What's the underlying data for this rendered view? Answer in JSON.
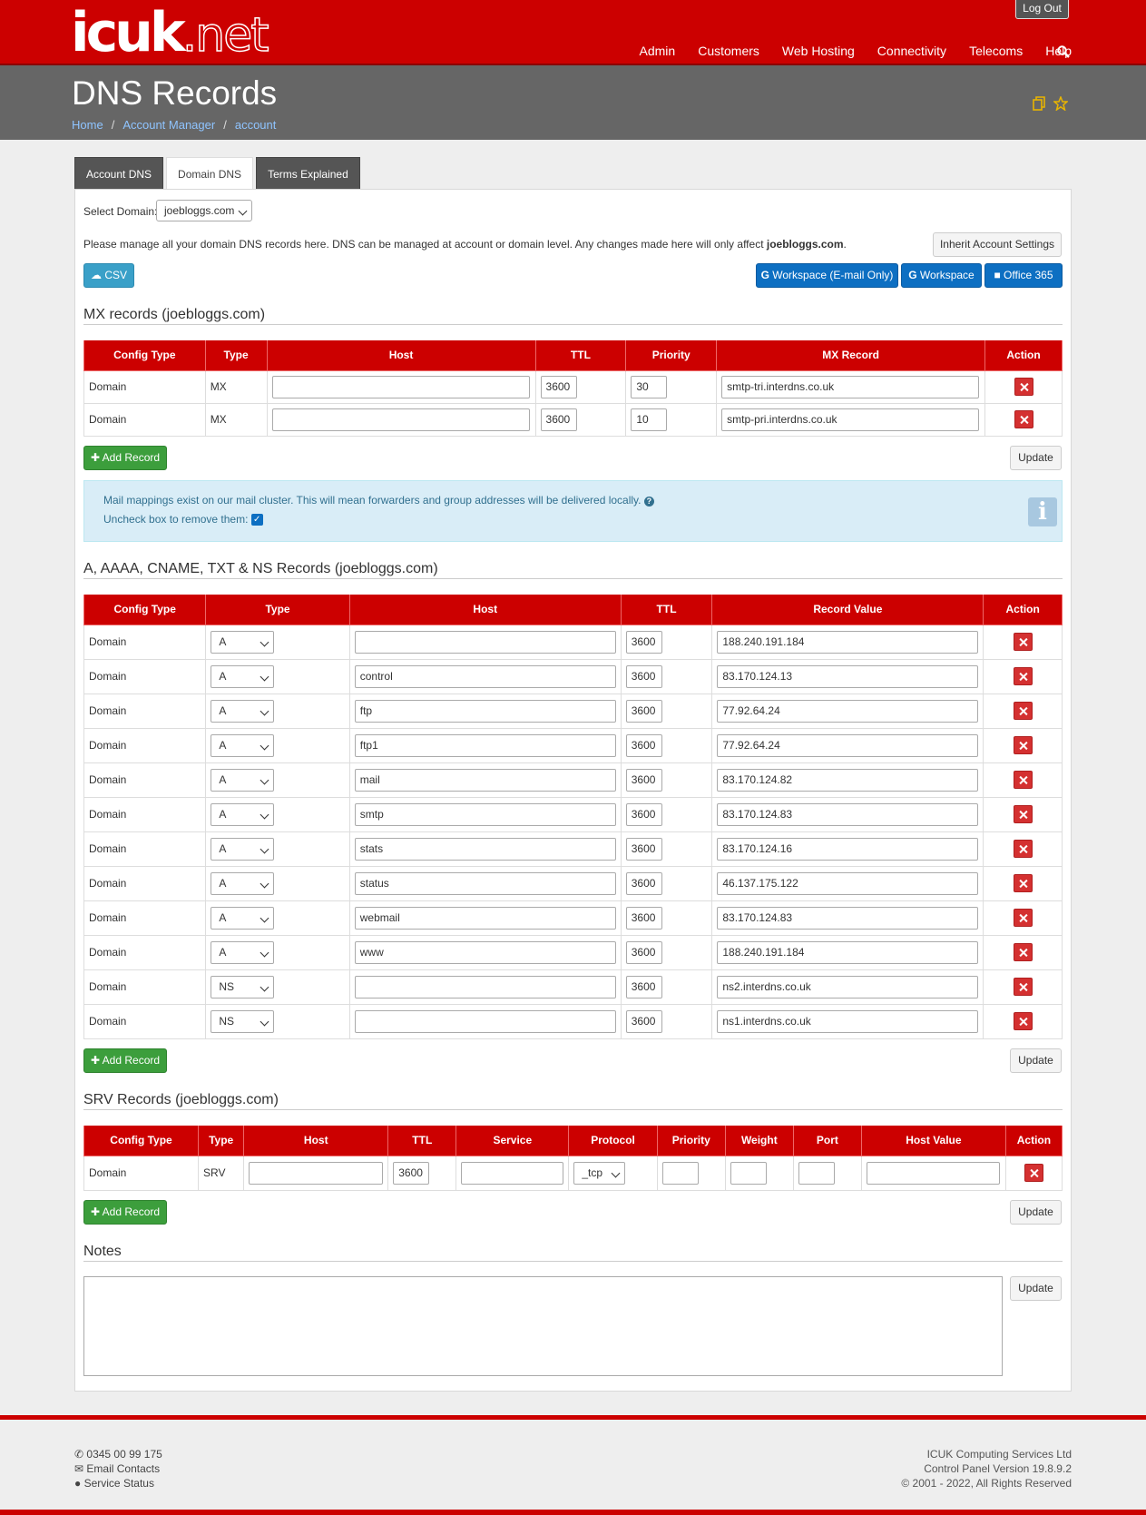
{
  "header": {
    "logo_main": "icuk",
    "logo_suffix": ".net",
    "logout": "Log Out",
    "nav": [
      "Admin",
      "Customers",
      "Web Hosting",
      "Connectivity",
      "Telecoms",
      "Help"
    ]
  },
  "page": {
    "title": "DNS Records",
    "breadcrumb": [
      "Home",
      "Account Manager",
      "account"
    ]
  },
  "tabs": [
    "Account DNS",
    "Domain DNS",
    "Terms Explained"
  ],
  "domain_select": {
    "label": "Select Domain:",
    "value": "joebloggs.com"
  },
  "intro": {
    "text": "Please manage all your domain DNS records here. DNS can be managed at account or domain level. Any changes made here will only affect ",
    "domain": "joebloggs.com",
    "suffix": "."
  },
  "buttons": {
    "inherit": "Inherit Account Settings",
    "csv": "CSV",
    "workspace_email": "Workspace (E-mail Only)",
    "workspace": "Workspace",
    "office": "Office 365",
    "add_record": "Add Record",
    "update": "Update"
  },
  "mx": {
    "title": "MX records (joebloggs.com)",
    "headers": [
      "Config Type",
      "Type",
      "Host",
      "TTL",
      "Priority",
      "MX Record",
      "Action"
    ],
    "rows": [
      {
        "config": "Domain",
        "type": "MX",
        "host": "",
        "ttl": "3600",
        "priority": "30",
        "value": "smtp-tri.interdns.co.uk"
      },
      {
        "config": "Domain",
        "type": "MX",
        "host": "",
        "ttl": "3600",
        "priority": "10",
        "value": "smtp-pri.interdns.co.uk"
      }
    ]
  },
  "info": {
    "line1": "Mail mappings exist on our mail cluster. This will mean forwarders and group addresses will be delivered locally.",
    "line2": "Uncheck box to remove them:"
  },
  "records": {
    "title": "A, AAAA, CNAME, TXT & NS Records (joebloggs.com)",
    "headers": [
      "Config Type",
      "Type",
      "Host",
      "TTL",
      "Record Value",
      "Action"
    ],
    "rows": [
      {
        "config": "Domain",
        "type": "A",
        "host": "",
        "ttl": "3600",
        "value": "188.240.191.184"
      },
      {
        "config": "Domain",
        "type": "A",
        "host": "control",
        "ttl": "3600",
        "value": "83.170.124.13"
      },
      {
        "config": "Domain",
        "type": "A",
        "host": "ftp",
        "ttl": "3600",
        "value": "77.92.64.24"
      },
      {
        "config": "Domain",
        "type": "A",
        "host": "ftp1",
        "ttl": "3600",
        "value": "77.92.64.24"
      },
      {
        "config": "Domain",
        "type": "A",
        "host": "mail",
        "ttl": "3600",
        "value": "83.170.124.82"
      },
      {
        "config": "Domain",
        "type": "A",
        "host": "smtp",
        "ttl": "3600",
        "value": "83.170.124.83"
      },
      {
        "config": "Domain",
        "type": "A",
        "host": "stats",
        "ttl": "3600",
        "value": "83.170.124.16"
      },
      {
        "config": "Domain",
        "type": "A",
        "host": "status",
        "ttl": "3600",
        "value": "46.137.175.122"
      },
      {
        "config": "Domain",
        "type": "A",
        "host": "webmail",
        "ttl": "3600",
        "value": "83.170.124.83"
      },
      {
        "config": "Domain",
        "type": "A",
        "host": "www",
        "ttl": "3600",
        "value": "188.240.191.184"
      },
      {
        "config": "Domain",
        "type": "NS",
        "host": "",
        "ttl": "3600",
        "value": "ns2.interdns.co.uk"
      },
      {
        "config": "Domain",
        "type": "NS",
        "host": "",
        "ttl": "3600",
        "value": "ns1.interdns.co.uk"
      }
    ]
  },
  "srv": {
    "title": "SRV Records (joebloggs.com)",
    "headers": [
      "Config Type",
      "Type",
      "Host",
      "TTL",
      "Service",
      "Protocol",
      "Priority",
      "Weight",
      "Port",
      "Host Value",
      "Action"
    ],
    "rows": [
      {
        "config": "Domain",
        "type": "SRV",
        "host": "",
        "ttl": "3600",
        "service": "",
        "protocol": "_tcp",
        "priority": "",
        "weight": "",
        "port": "",
        "hostvalue": ""
      }
    ]
  },
  "notes": {
    "title": "Notes",
    "value": ""
  },
  "footer": {
    "phone": "0345 00 99 175",
    "email": "Email Contacts",
    "status": "Service Status",
    "company": "ICUK Computing Services Ltd",
    "version": "Control Panel Version 19.8.9.2",
    "copyright": "© 2001 - 2022, All Rights Reserved"
  }
}
